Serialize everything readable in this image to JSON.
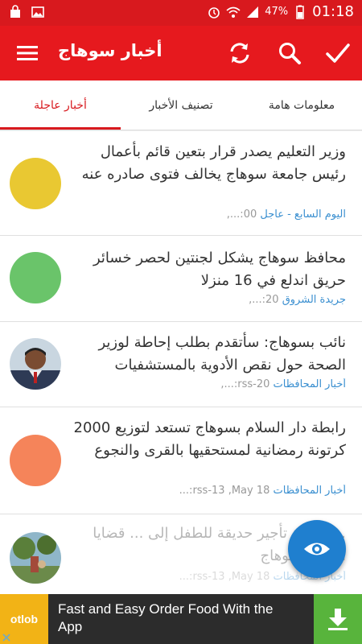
{
  "status_bar": {
    "battery": "47%",
    "time": "01:18"
  },
  "app_bar": {
    "title": "أخبار سوهاج"
  },
  "tabs": [
    {
      "label": "معلومات هامة"
    },
    {
      "label": "تصنيف الأخبار"
    },
    {
      "label": "أخبار عاجلة",
      "selected": true
    }
  ],
  "news": [
    {
      "headline": "وزير التعليم يصدر قرار بتعين قائم بأعمال رئيس جامعة سوهاج يخالف فتوى صادره عنه",
      "source": "اليوم السابع - عاجل",
      "time": "00:...,",
      "thumb_color": "#e9c832"
    },
    {
      "headline": "محافظ سوهاج يشكل لجنتين لحصر خسائر حريق اندلع في 16 منزلا",
      "source": "جريدة الشروق",
      "time": "20:...,",
      "thumb_color": "#6ac46a"
    },
    {
      "headline": "نائب بسوهاج: سأتقدم بطلب إحاطة لوزير الصحة حول نقص الأدوية بالمستشفيات",
      "source": "أخبار المحافظات",
      "time": "rss-20:...,",
      "thumb_color": "photo"
    },
    {
      "headline": "رابطة دار السلام بسوهاج تستعد لتوزيع 2000 كرتونة رمضانية لمستحقيها بالقرى والنجوع",
      "source": "أخبار المحافظات",
      "time": "rss-13 ,May 18:...",
      "thumb_color": "#f5845a"
    },
    {
      "headline": "... حقيقة تأجير حديقة للطفل إلى ... قضايا الدولة بسوهاج",
      "source": "أخبار المحافظات",
      "time": "rss-13 ,May 18:...",
      "thumb_color": "photo"
    }
  ],
  "ad": {
    "brand": "otlob",
    "text": "Fast and Easy Order Food With the App"
  },
  "colors": {
    "primary": "#e6191e",
    "accent_tab": "#d8191e",
    "source_link": "#3a8fd0",
    "fab": "#1f7fcf",
    "ad_download": "#58b43c"
  }
}
